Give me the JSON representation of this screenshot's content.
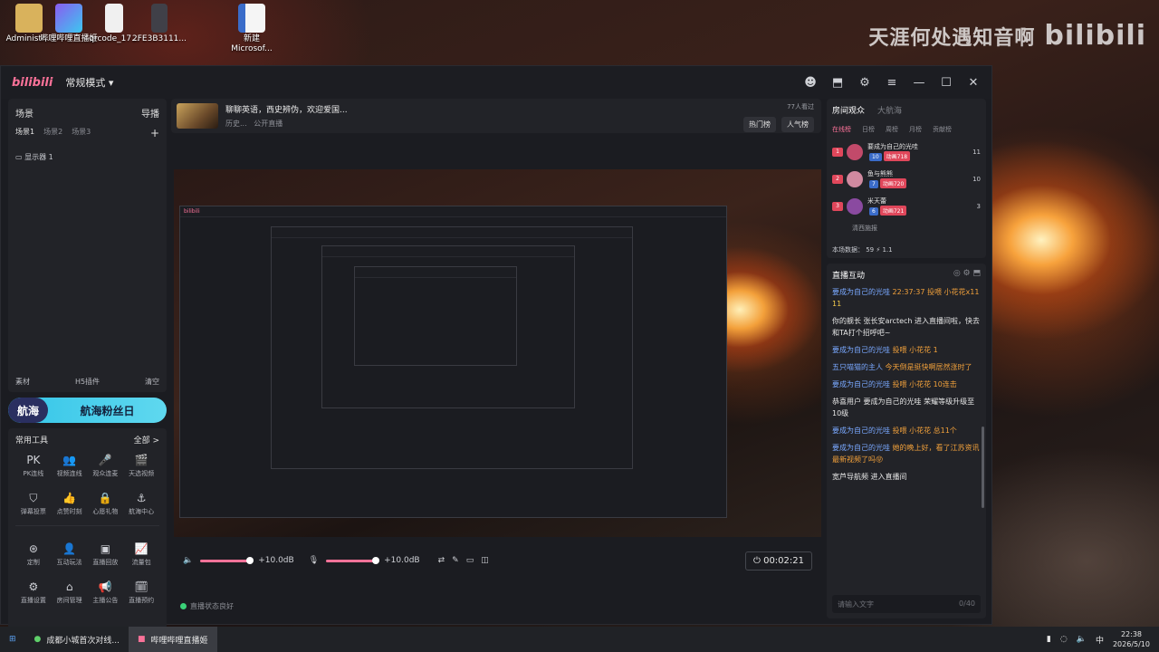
{
  "desktop": {
    "icons": [
      {
        "label": "Administr...",
        "color": "#d9b25c"
      },
      {
        "label": "哔哩哔哩直播姬",
        "color": "#8a5cf0"
      },
      {
        "label": "qrcode_17...",
        "color": "#f0f0f0"
      },
      {
        "label": "2FE3B3111...",
        "color": "#404048"
      },
      {
        "label": "新建 Microsof...",
        "color": "#3a6cc9"
      }
    ],
    "watermark_text": "天涯何处遇知音啊",
    "watermark_logo": "bilibili"
  },
  "window": {
    "brand": "bilibili",
    "mode_label": "常规模式 ▾",
    "controls": [
      "☻",
      "⬒",
      "⚙",
      "≡",
      "—",
      "☐",
      "✕"
    ]
  },
  "scene_panel": {
    "title": "场景",
    "guide_label": "导播",
    "tabs": [
      "场景1",
      "场景2",
      "场景3"
    ],
    "add": "+",
    "source": "显示器 1",
    "footer": [
      "素材",
      "H5插件",
      "清空"
    ]
  },
  "fan_day": {
    "tag": "航海",
    "label": "航海粉丝日"
  },
  "tools": {
    "title": "常用工具",
    "all_label": "全部 >",
    "items": [
      {
        "icon": "PK",
        "label": "PK连线"
      },
      {
        "icon": "👥",
        "label": "视频连线"
      },
      {
        "icon": "🎤",
        "label": "观众连麦"
      },
      {
        "icon": "🎬",
        "label": "天选视频"
      },
      {
        "icon": "⛉",
        "label": "弹幕投票"
      },
      {
        "icon": "👍",
        "label": "点赞时刻"
      },
      {
        "icon": "🔒",
        "label": "心愿礼物"
      },
      {
        "icon": "⚓",
        "label": "航海中心"
      },
      {
        "icon": "⊛",
        "label": "定制"
      },
      {
        "icon": "👤",
        "label": "互动玩法"
      },
      {
        "icon": "▣",
        "label": "直播回放"
      },
      {
        "icon": "📈",
        "label": "流量包"
      },
      {
        "icon": "⚙",
        "label": "直播设置"
      },
      {
        "icon": "⌂",
        "label": "房间管理"
      },
      {
        "icon": "📢",
        "label": "主播公告"
      },
      {
        "icon": "🗓",
        "label": "直播预约"
      }
    ]
  },
  "room": {
    "title": "聊聊英语，西史辨伪，欢迎爱国...",
    "category": "历史...",
    "visibility": "公开直播",
    "viewers": "77人看过",
    "hot_btn": "热门榜",
    "pop_btn": "人气榜"
  },
  "controls": {
    "vol1": "+10.0dB",
    "vol2": "+10.0dB",
    "timer": "00:02:21",
    "status": "直播状态良好"
  },
  "audience": {
    "tabs": [
      "房间观众",
      "大航海"
    ],
    "subtabs": [
      "在线榜",
      "日榜",
      "周榜",
      "月榜",
      "贡献榜"
    ],
    "rows": [
      {
        "rank": "1",
        "name": "要成为自己的光哇",
        "lvl": "10",
        "medal": "动画718",
        "value": "11",
        "color": "#c24a6a"
      },
      {
        "rank": "2",
        "name": "鱼与熊熊",
        "lvl": "7",
        "medal": "动画720",
        "value": "10",
        "color": "#d08aa0"
      },
      {
        "rank": "3",
        "name": "米天蕾",
        "lvl": "6",
        "medal": "动画721",
        "value": "3",
        "color": "#8a4aa0"
      }
    ],
    "partial_row": "清西施报",
    "stats": "本场数据： 59 ⚡ 1.1"
  },
  "interaction": {
    "title": "直播互动",
    "messages": [
      {
        "user": "要成为自己的光哇",
        "text": "22:37:37 投喂 小花花x11",
        "extra": "11",
        "time": "22:37:37"
      },
      {
        "user": "",
        "text": "你的舰长 张长安arctech 进入直播间啦，快去和TA打个招呼吧~"
      },
      {
        "user": "要成为自己的光哇",
        "text": "投喂 小花花 1"
      },
      {
        "user": "五只喵猫的主人",
        "text": "今天倒是挺快啊居然涨时了"
      },
      {
        "user": "要成为自己的光哇",
        "text": "投喂 小花花 10连击"
      },
      {
        "user": "",
        "text": "恭喜用户 要成为自己的光哇 荣耀等级升级至10级"
      },
      {
        "user": "要成为自己的光哇",
        "text": "投喂 小花花 总11个"
      },
      {
        "user": "要成为自己的光哇",
        "text": "她的晚上好，看了江苏资讯最新视频了吗😝"
      },
      {
        "user": "",
        "text": "宽芦导航频 进入直播间"
      }
    ],
    "input_placeholder": "请输入文字",
    "input_count": "0/40"
  },
  "taskbar": {
    "tasks": [
      "成都小城首次对线...",
      "哔哩哔哩直播姬"
    ],
    "tray_lang": "中",
    "tray_time": "22:38",
    "tray_date": "2026/5/10"
  }
}
